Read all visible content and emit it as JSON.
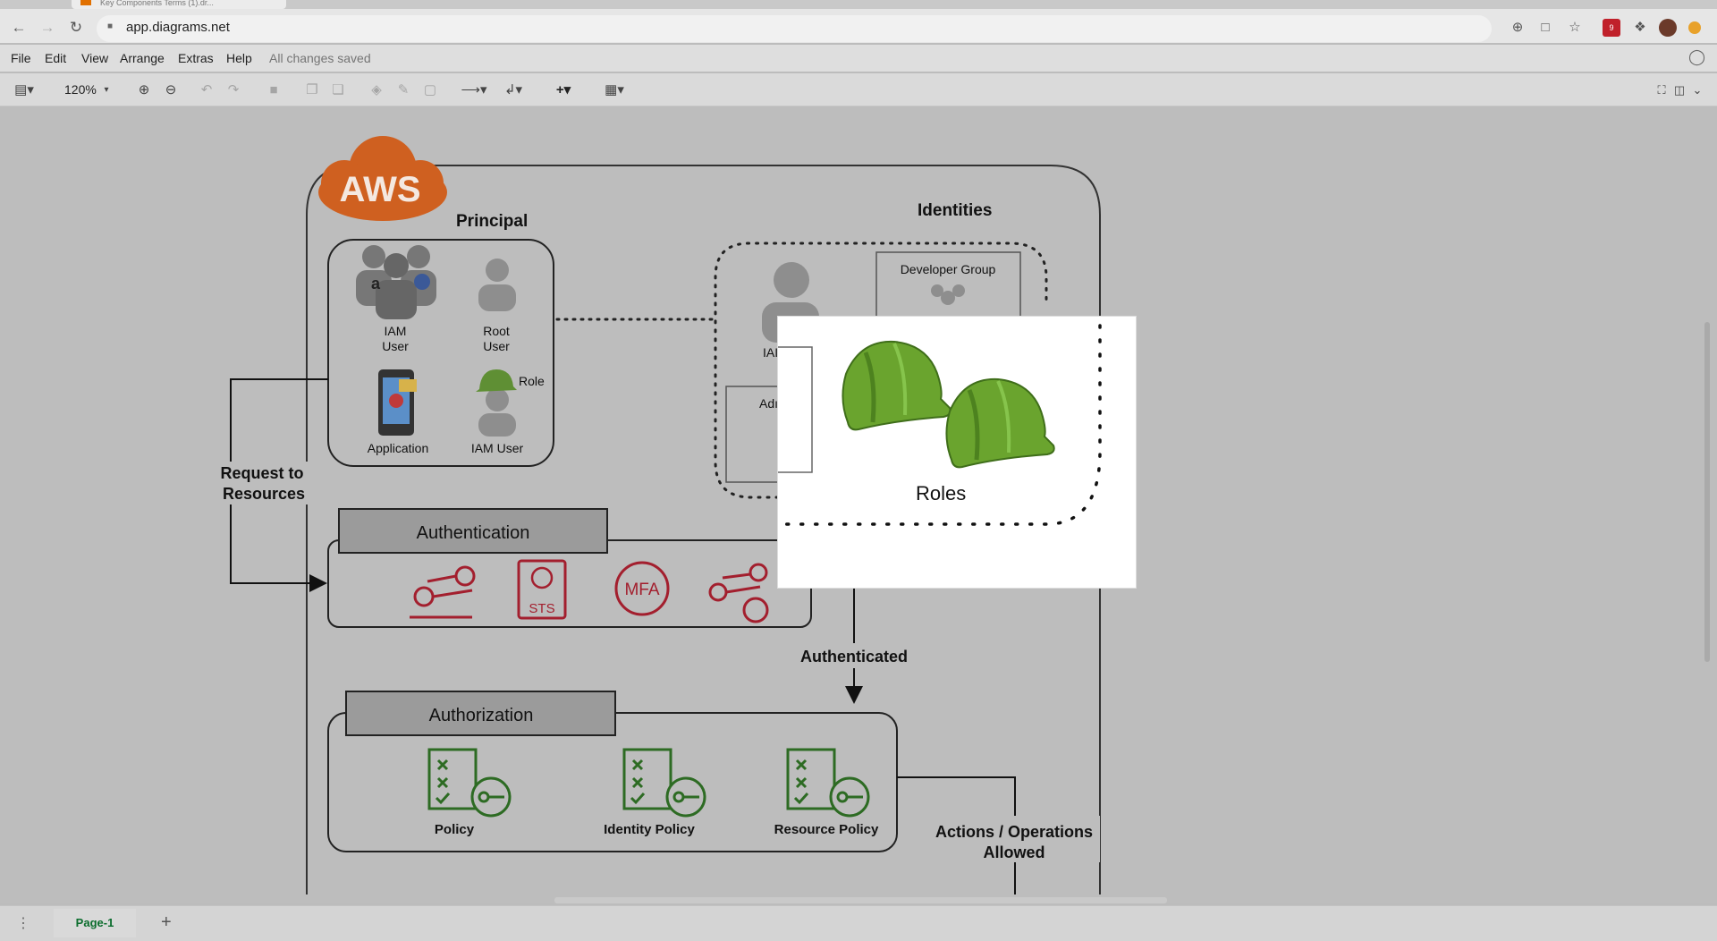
{
  "browser": {
    "tab_title": "Key Components Terms (1).dr...",
    "url": "app.diagrams.net",
    "back_icon": "←",
    "forward_icon": "→",
    "reload_icon": "↻",
    "lock_icon": "🔒",
    "extension_badge": "9"
  },
  "menu": {
    "items": [
      "File",
      "Edit",
      "View",
      "Arrange",
      "Extras",
      "Help"
    ],
    "status": "All changes saved"
  },
  "toolbar": {
    "zoom": "120%"
  },
  "diagram": {
    "aws_logo": "AWS",
    "principal_title": "Principal",
    "identities_title": "Identities",
    "iam_user_1": "IAM",
    "iam_user_2": "User",
    "root_user_1": "Root",
    "root_user_2": "User",
    "role_label": "Role",
    "application_label": "Application",
    "iam_user_label": "IAM User",
    "developer_group": "Developer Group",
    "iam_partial": "IAI",
    "admin_partial": "Adı",
    "request_1": "Request to",
    "request_2": "Resources",
    "authentication": "Authentication",
    "sts": "STS",
    "mfa": "MFA",
    "authenticated": "Authenticated",
    "authorization": "Authorization",
    "policy": "Policy",
    "identity_policy": "Identity Policy",
    "resource_policy": "Resource Policy",
    "actions_1": "Actions / Operations",
    "actions_2": "Allowed",
    "roles": "Roles"
  },
  "pages": {
    "current": "Page-1",
    "add": "+"
  },
  "colors": {
    "aws_orange": "#cf6020",
    "auth_red": "#a31f2e",
    "policy_green": "#2d6b23",
    "hat_green": "#6aa42e"
  }
}
